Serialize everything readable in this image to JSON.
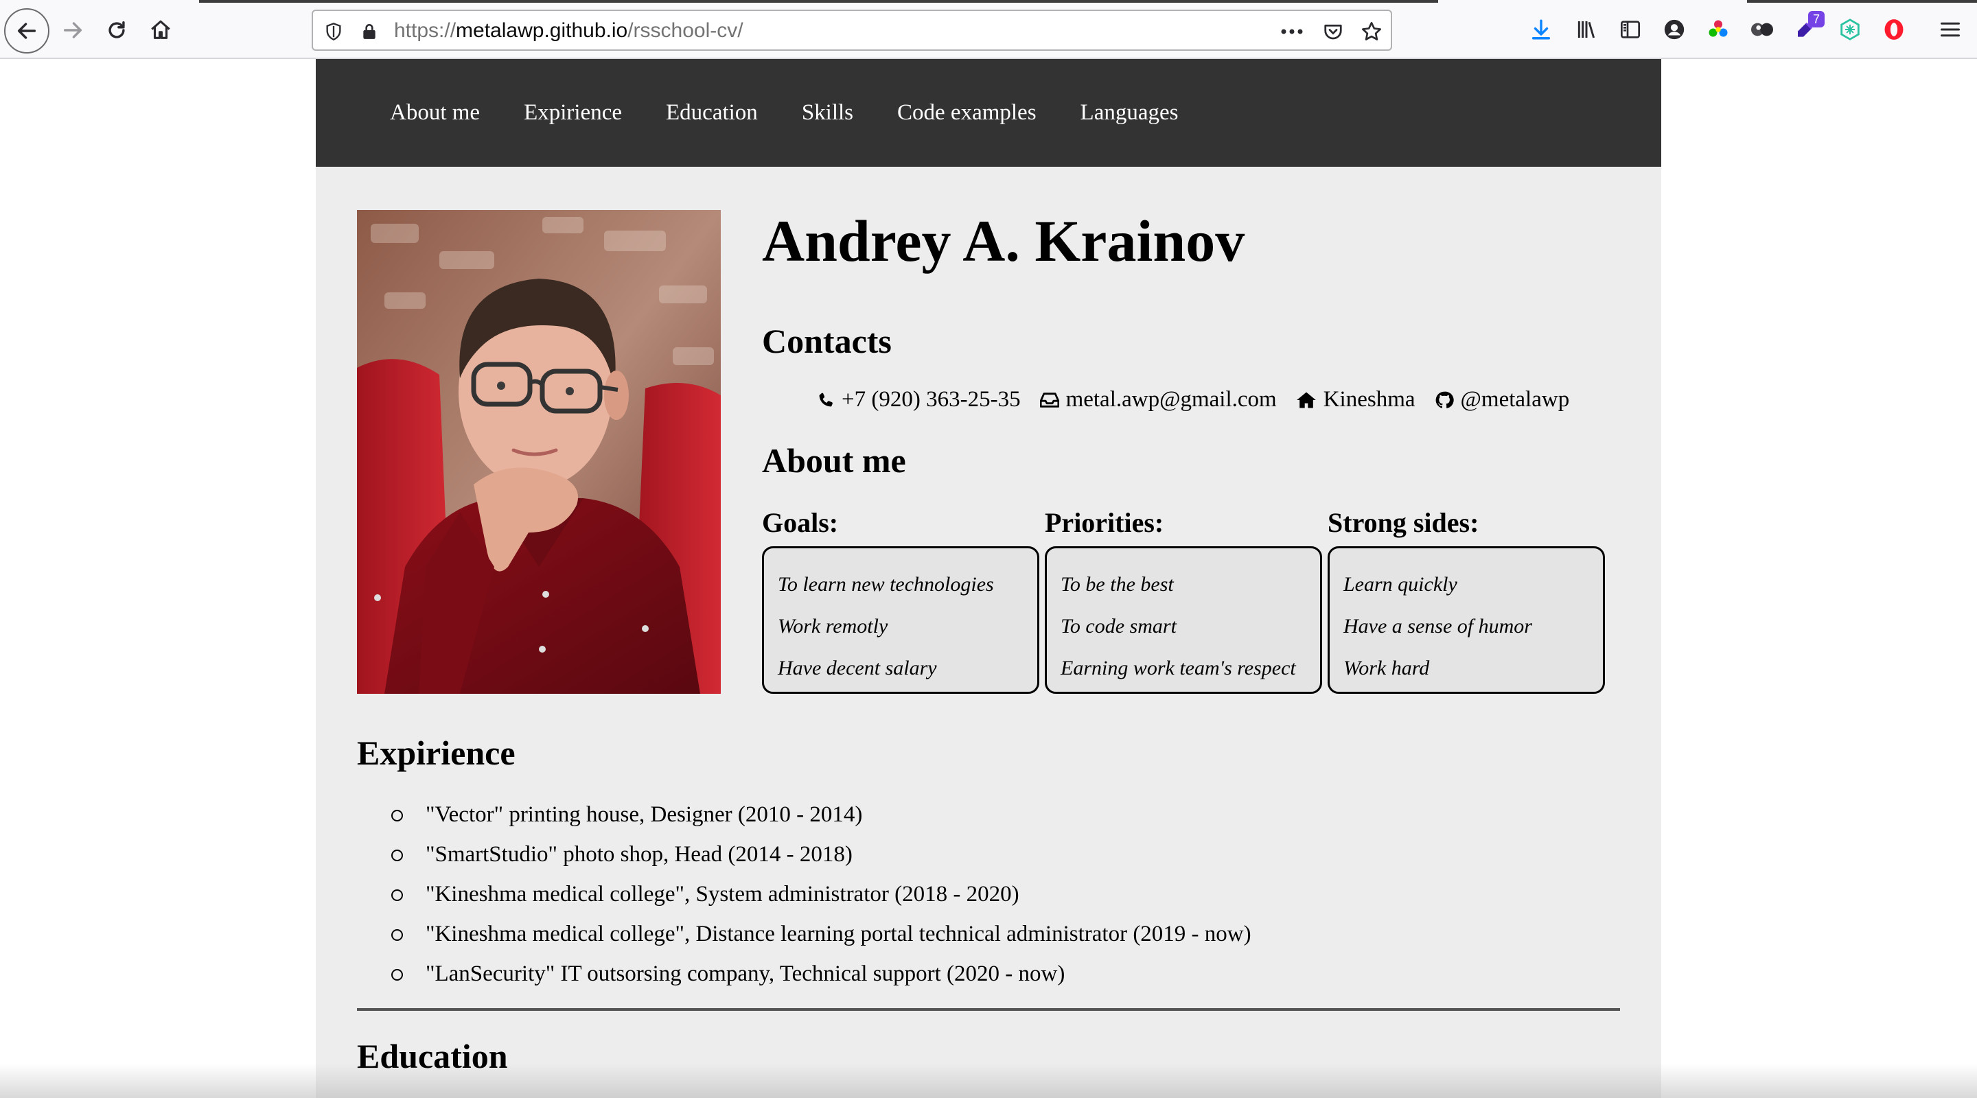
{
  "browser": {
    "url_scheme": "https://",
    "url_host": "metalawp.github.io",
    "url_path": "/rsschool-cv/",
    "extension_badge": "7",
    "icons": [
      "back-arrow-icon",
      "forward-arrow-icon",
      "reload-icon",
      "home-icon",
      "shield-icon",
      "lock-icon",
      "more-dots-icon",
      "pocket-icon",
      "bookmark-star-icon",
      "download-icon",
      "library-icon",
      "sidebar-icon",
      "account-icon",
      "colorful-extension-icon",
      "extension-icon",
      "extension-badge-icon",
      "vpn-icon",
      "opera-icon",
      "menu-icon"
    ]
  },
  "nav": {
    "items": [
      "About me",
      "Expirience",
      "Education",
      "Skills",
      "Code examples",
      "Languages"
    ]
  },
  "profile": {
    "name": "Andrey A. Krainov"
  },
  "contacts": {
    "title": "Contacts",
    "phone": "+7 (920) 363-25-35",
    "email": "metal.awp@gmail.com",
    "city": "Kineshma",
    "github": "@metalawp"
  },
  "about": {
    "title": "About me",
    "columns": [
      {
        "title": "Goals:",
        "items": [
          "To learn new technologies",
          "Work remotly",
          "Have decent salary"
        ]
      },
      {
        "title": "Priorities:",
        "items": [
          "To be the best",
          "To code smart",
          "Earning work team's respect"
        ]
      },
      {
        "title": "Strong sides:",
        "items": [
          "Learn quickly",
          "Have a sense of humor",
          "Work hard"
        ]
      }
    ]
  },
  "experience": {
    "title": "Expirience",
    "items": [
      "\"Vector\" printing house, Designer (2010 - 2014)",
      "\"SmartStudio\" photo shop, Head (2014 - 2018)",
      "\"Kineshma medical college\", System administrator (2018 - 2020)",
      "\"Kineshma medical college\", Distance learning portal technical administrator (2019 - now)",
      "\"LanSecurity\" IT outsorsing company, Technical support (2020 - now)"
    ]
  },
  "education": {
    "title": "Education"
  },
  "colors": {
    "nav_bg": "#333333",
    "page_bg": "#ededed",
    "box_bg": "#e4e4e4"
  }
}
